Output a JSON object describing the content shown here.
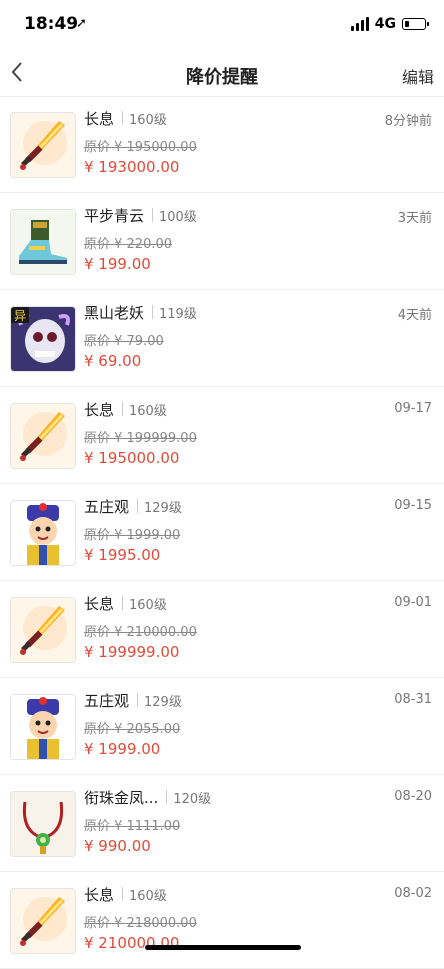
{
  "status": {
    "time": "18:49",
    "network": "4G",
    "battery_level": 0.25
  },
  "nav": {
    "back_icon": "chevron-left-icon",
    "title": "降价提醒",
    "edit_label": "编辑"
  },
  "items": [
    {
      "name": "长息",
      "level": "160级",
      "time": "8分钟前",
      "original_price": "原价 ¥ 195000.00",
      "price": "¥ 193000.00",
      "icon": "sword-icon"
    },
    {
      "name": "平步青云",
      "level": "100级",
      "time": "3天前",
      "original_price": "原价 ¥ 220.00",
      "price": "¥ 199.00",
      "icon": "boots-icon"
    },
    {
      "name": "黑山老妖",
      "level": "119级",
      "time": "4天前",
      "original_price": "原价 ¥ 79.00",
      "price": "¥ 69.00",
      "icon": "skull-demon-icon",
      "badge": "异"
    },
    {
      "name": "长息",
      "level": "160级",
      "time": "09-17",
      "original_price": "原价 ¥ 199999.00",
      "price": "¥ 195000.00",
      "icon": "sword-icon"
    },
    {
      "name": "五庄观",
      "level": "129级",
      "time": "09-15",
      "original_price": "原价 ¥ 1999.00",
      "price": "¥ 1995.00",
      "icon": "monk-character-icon"
    },
    {
      "name": "长息",
      "level": "160级",
      "time": "09-01",
      "original_price": "原价 ¥ 210000.00",
      "price": "¥ 199999.00",
      "icon": "sword-icon"
    },
    {
      "name": "五庄观",
      "level": "129级",
      "time": "08-31",
      "original_price": "原价 ¥ 2055.00",
      "price": "¥ 1999.00",
      "icon": "monk-character-icon"
    },
    {
      "name": "衔珠金凤...",
      "level": "120级",
      "time": "08-20",
      "original_price": "原价 ¥ 1111.00",
      "price": "¥ 990.00",
      "icon": "necklace-icon"
    },
    {
      "name": "长息",
      "level": "160级",
      "time": "08-02",
      "original_price": "原价 ¥ 218000.00",
      "price": "¥ 210000.00",
      "icon": "sword-icon"
    }
  ]
}
